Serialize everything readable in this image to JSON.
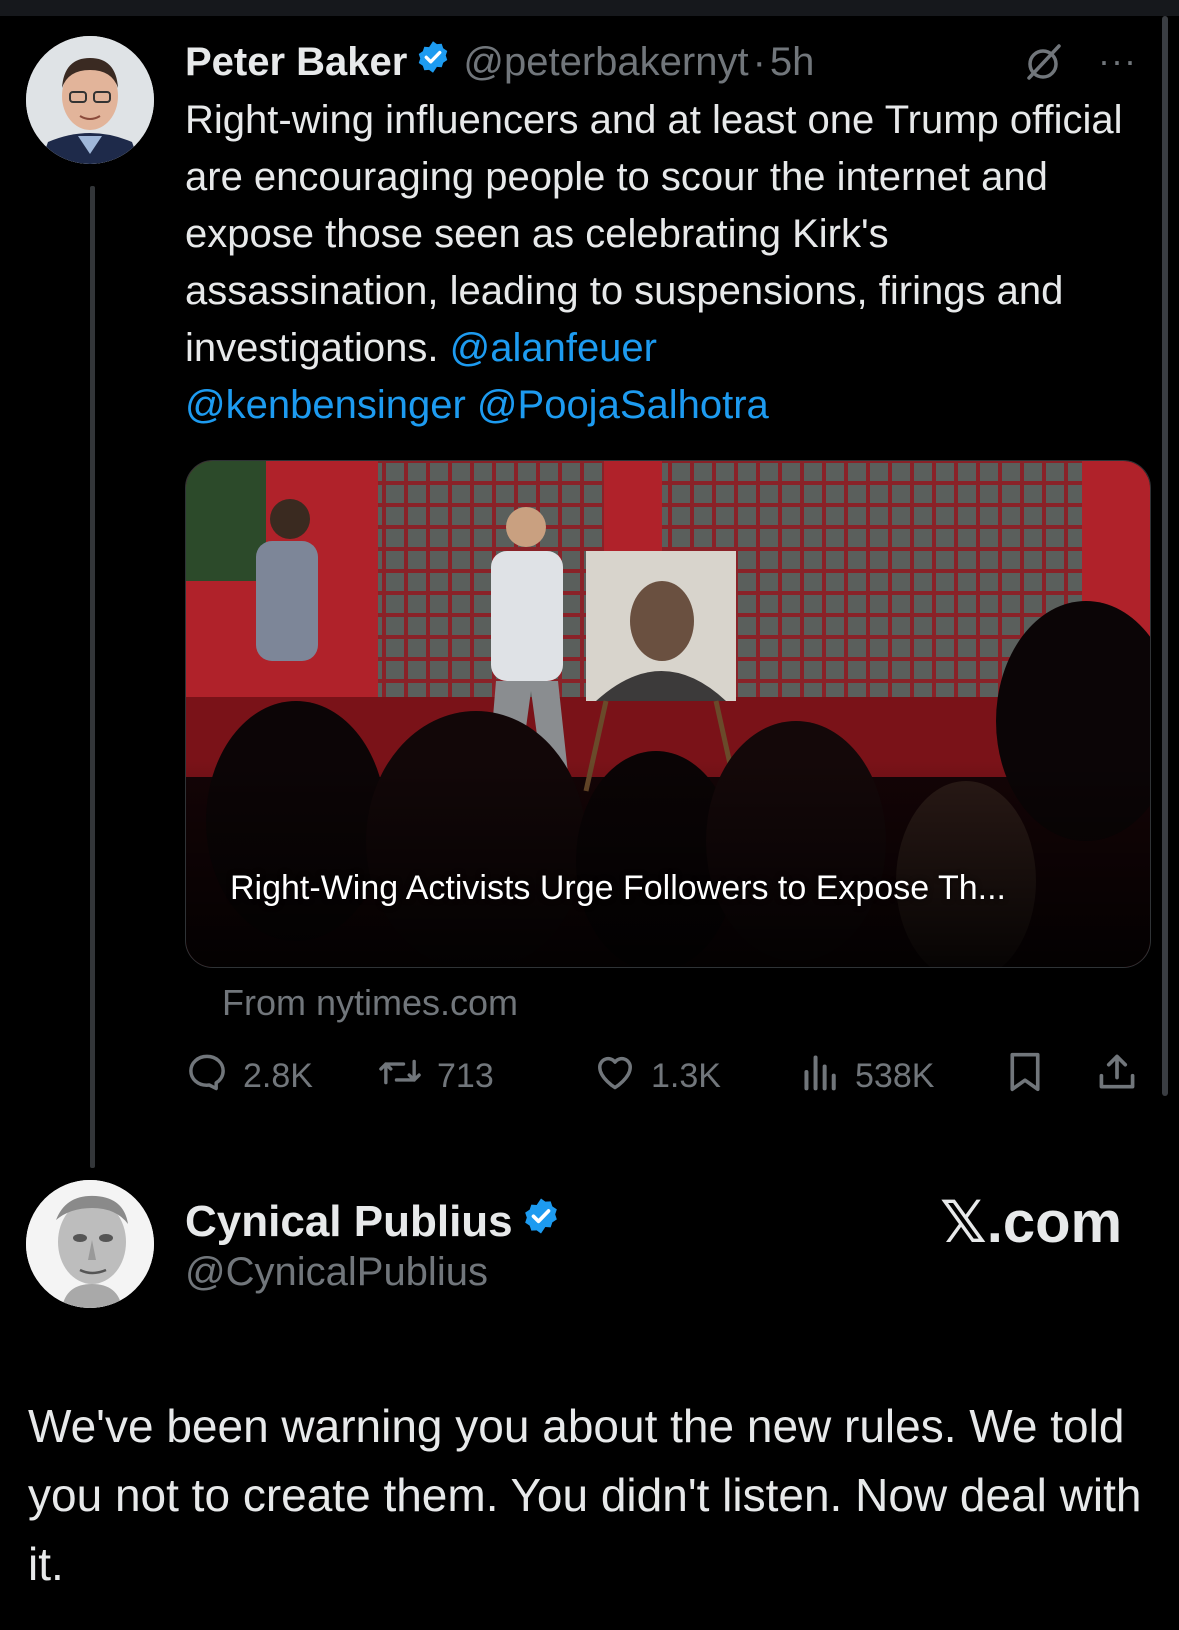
{
  "tweet": {
    "author_name": "Peter Baker",
    "author_handle": "@peterbakernyt",
    "separator": "·",
    "time": "5h",
    "text_plain": "Right-wing influencers and at least one Trump official are encouraging people to scour the internet and expose those seen as celebrating Kirk's assassination, leading to suspensions, firings and investigations. ",
    "mentions": [
      "@alanfeuer",
      "@kenbensinger",
      "@PoojaSalhotra"
    ],
    "card_title": "Right-Wing Activists Urge Followers to Expose Th...",
    "card_source": "From nytimes.com",
    "stats": {
      "replies": "2.8K",
      "reposts": "713",
      "likes": "1.3K",
      "views": "538K"
    }
  },
  "reply": {
    "author_name": "Cynical Publius",
    "author_handle": "@CynicalPublius",
    "watermark": "𝕏.com",
    "text": "We've been warning you about the new rules.  We told you not to create them. You didn't listen. Now deal with it."
  },
  "colors": {
    "background": "#000000",
    "text": "#e7e9ea",
    "secondary": "#71767b",
    "link": "#1d9bf0",
    "verified": "#1d9bf0"
  },
  "icons": [
    "verified-badge-icon",
    "grok-icon",
    "more-icon",
    "reply-icon",
    "repost-icon",
    "like-icon",
    "views-icon",
    "bookmark-icon",
    "share-icon"
  ]
}
